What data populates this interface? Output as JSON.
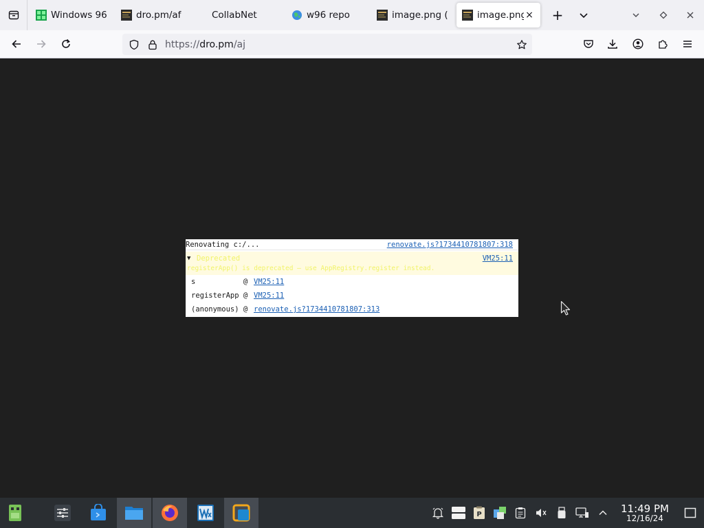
{
  "tabs": [
    {
      "label": "Windows 96",
      "icon": "windows96-icon",
      "active": false
    },
    {
      "label": "dro.pm/af",
      "icon": "image-thumb-icon",
      "active": false
    },
    {
      "label": "CollabNet",
      "icon": "",
      "active": false
    },
    {
      "label": "w96 repo",
      "icon": "globe-icon",
      "active": false
    },
    {
      "label": "image.png (",
      "icon": "image-thumb-icon",
      "active": false
    },
    {
      "label": "image.png",
      "icon": "image-thumb-icon",
      "active": true
    }
  ],
  "active_tab_close": "×",
  "new_tab_label": "+",
  "navbar": {
    "url_scheme": "https://",
    "url_host": "dro.pm",
    "url_path": "/aj"
  },
  "console": {
    "line1_text": "Renovating c:/...",
    "line1_source": "renovate.js?1734410781807:318",
    "warn_toggle": "▼",
    "warn_header": "Deprecated",
    "warn_message": "registerApp() is deprecated — use AppRegistry.register instead.",
    "warn_source": "VM25:11",
    "stack": [
      {
        "fn": "s           @ ",
        "source": "VM25:11"
      },
      {
        "fn": "registerApp @ ",
        "source": "VM25:11"
      },
      {
        "fn": "(anonymous) @ ",
        "source": "renovate.js?1734410781807:313"
      }
    ]
  },
  "taskbar": {
    "clock_time": "11:49 PM",
    "clock_date": "12/16/24"
  },
  "colors": {
    "content_bg": "#1f1f1f",
    "tab_strip_bg": "#f0f0f4",
    "taskbar_bg": "#2a2e32",
    "link": "#1a5fb4"
  }
}
